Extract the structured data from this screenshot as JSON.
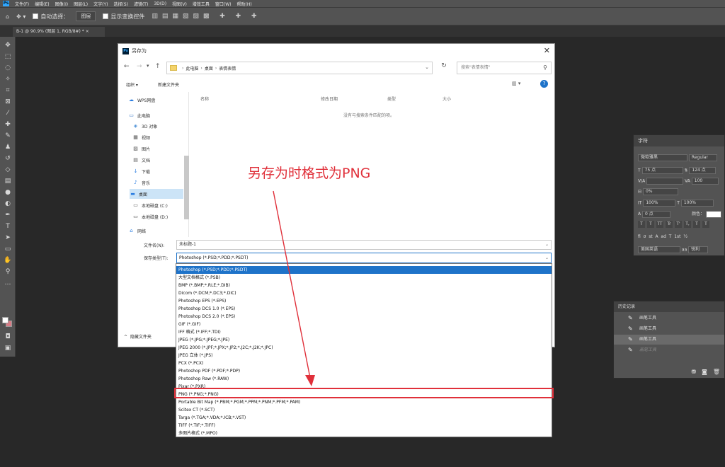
{
  "menubar": {
    "logo": "Ps",
    "items": [
      "文件(F)",
      "编辑(E)",
      "图像(I)",
      "图层(L)",
      "文字(Y)",
      "选择(S)",
      "滤镜(T)",
      "3D(D)",
      "视图(V)",
      "增效工具",
      "窗口(W)",
      "帮助(H)"
    ]
  },
  "options_bar": {
    "auto_select_label": "自动选择：",
    "auto_select_value": "图层",
    "show_transform_label": "显示变换控件"
  },
  "doc_tab": {
    "label": "B-1 @ 90.9% (图层 1, RGB/8#) *",
    "close": "×"
  },
  "char_panel": {
    "title": "字符",
    "font_family": "微软雅黑",
    "font_style": "Regular",
    "size": "75 点",
    "leading": "124 点",
    "kerning": "V/A",
    "tracking": "100",
    "baseline_scale": "0%",
    "vscale": "100%",
    "hscale": "100%",
    "baseline_shift": "0 点",
    "color_label": "颜色：",
    "language": "美国英语",
    "aa": "锐利",
    "styles": [
      "T",
      "T",
      "TT",
      "Tr",
      "T'",
      "T,",
      "T",
      "T"
    ]
  },
  "history_panel": {
    "title": "历史记录",
    "items": [
      {
        "label": "画笔工具",
        "state": "normal"
      },
      {
        "label": "画笔工具",
        "state": "normal"
      },
      {
        "label": "画笔工具",
        "state": "selected"
      },
      {
        "label": "画笔工具",
        "state": "undone"
      }
    ]
  },
  "dialog": {
    "title": "另存为",
    "close": "✕",
    "address": [
      "此电脑",
      "桌面",
      "表情表情"
    ],
    "search_placeholder": "搜索\"表情表情\"",
    "organize": "组织 ▾",
    "new_folder": "新建文件夹",
    "nav_items": [
      "WPS网盘",
      "此电脑",
      "3D 对象",
      "视频",
      "图片",
      "文档",
      "下载",
      "音乐",
      "桌面",
      "本地磁盘 (C:)",
      "本地磁盘 (D:)",
      "网络"
    ],
    "nav_selected": "桌面",
    "columns": [
      "名称",
      "修改日期",
      "类型",
      "大小"
    ],
    "empty_message": "没有与搜索条件匹配的项。",
    "filename_label": "文件名(N):",
    "filename_value": "未标题-1",
    "savetype_label": "保存类型(T):",
    "savetype_value": "Photoshop (*.PSD;*.PDD;*.PSDT)",
    "hide_folders": "隐藏文件夹"
  },
  "type_options": [
    "Photoshop (*.PSD;*.PDD;*.PSDT)",
    "大型文档格式 (*.PSB)",
    "BMP (*.BMP;*.RLE;*.DIB)",
    "Dicom (*.DCM;*.DC3;*.DIC)",
    "Photoshop EPS (*.EPS)",
    "Photoshop DCS 1.0 (*.EPS)",
    "Photoshop DCS 2.0 (*.EPS)",
    "GIF (*.GIF)",
    "IFF 格式 (*.IFF;*.TDI)",
    "JPEG (*.JPG;*.JPEG;*.JPE)",
    "JPEG 2000 (*.JPF;*.JPX;*.JP2;*.J2C;*.J2K;*.JPC)",
    "JPEG 立体 (*.JPS)",
    "PCX (*.PCX)",
    "Photoshop PDF (*.PDF;*.PDP)",
    "Photoshop Raw (*.RAW)",
    "Pixar (*.PXR)",
    "PNG (*.PNG;*.PNG)",
    "Portable Bit Map (*.PBM;*.PGM;*.PPM;*.PNM;*.PFM;*.PAM)",
    "Scitex CT (*.SCT)",
    "Targa (*.TGA;*.VDA;*.ICB;*.VST)",
    "TIFF (*.TIF;*.TIFF)",
    "多图片格式 (*.MPO)"
  ],
  "type_selected_index": 0,
  "type_highlight_index": 16,
  "annotation": {
    "text": "另存为时格式为PNG",
    "color": "#e0303a"
  }
}
